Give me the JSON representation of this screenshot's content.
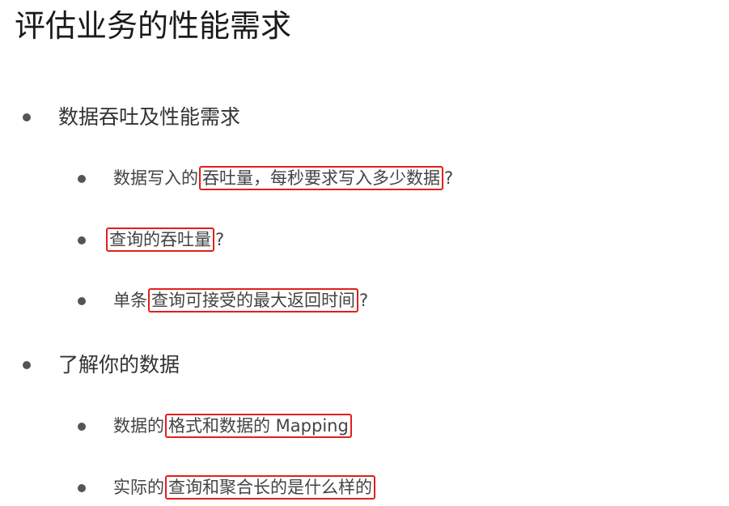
{
  "slide": {
    "title": "评估业务的性能需求",
    "sections": [
      {
        "label": "数据吞吐及性能需求",
        "items": [
          {
            "prefix": "数据写入的",
            "highlight": "吞吐量，每秒要求写入多少数据",
            "suffix": "?"
          },
          {
            "prefix": "",
            "highlight": "查询的吞吐量",
            "suffix": "?"
          },
          {
            "prefix": "单条",
            "highlight": "查询可接受的最大返回时间",
            "suffix": "?"
          }
        ]
      },
      {
        "label": "了解你的数据",
        "items": [
          {
            "prefix": "数据的",
            "highlight": "格式和数据的 Mapping",
            "suffix": ""
          },
          {
            "prefix": "实际的",
            "highlight": "查询和聚合长的是什么样的",
            "suffix": ""
          }
        ]
      }
    ],
    "highlight_color": "#e0201b"
  }
}
